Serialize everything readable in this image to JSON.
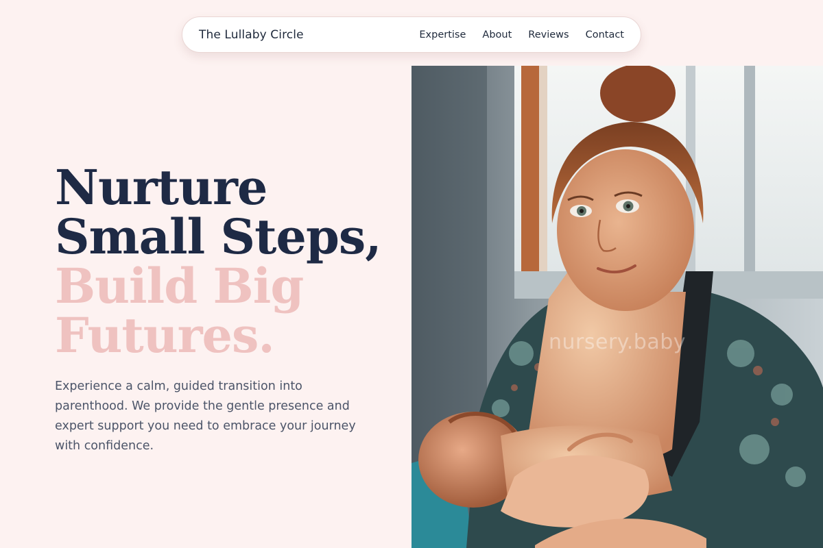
{
  "nav": {
    "brand": "The Lullaby Circle",
    "links": [
      {
        "label": "Expertise"
      },
      {
        "label": "About"
      },
      {
        "label": "Reviews"
      },
      {
        "label": "Contact"
      }
    ]
  },
  "hero": {
    "title_lines": [
      {
        "text": "Nurture"
      },
      {
        "text": "Small Steps,"
      },
      {
        "text": "Build Big"
      },
      {
        "text": "Futures."
      }
    ],
    "description": "Experience a calm, guided transition into parenthood. We provide the gentle presence and expert support you need to embrace your journey with confidence.",
    "image_watermark": "nursery.baby"
  },
  "colors": {
    "background": "#fdf2f1",
    "title_dark": "#1e2a45",
    "title_accent": "#efc2c0",
    "body_text": "#4b5468"
  }
}
